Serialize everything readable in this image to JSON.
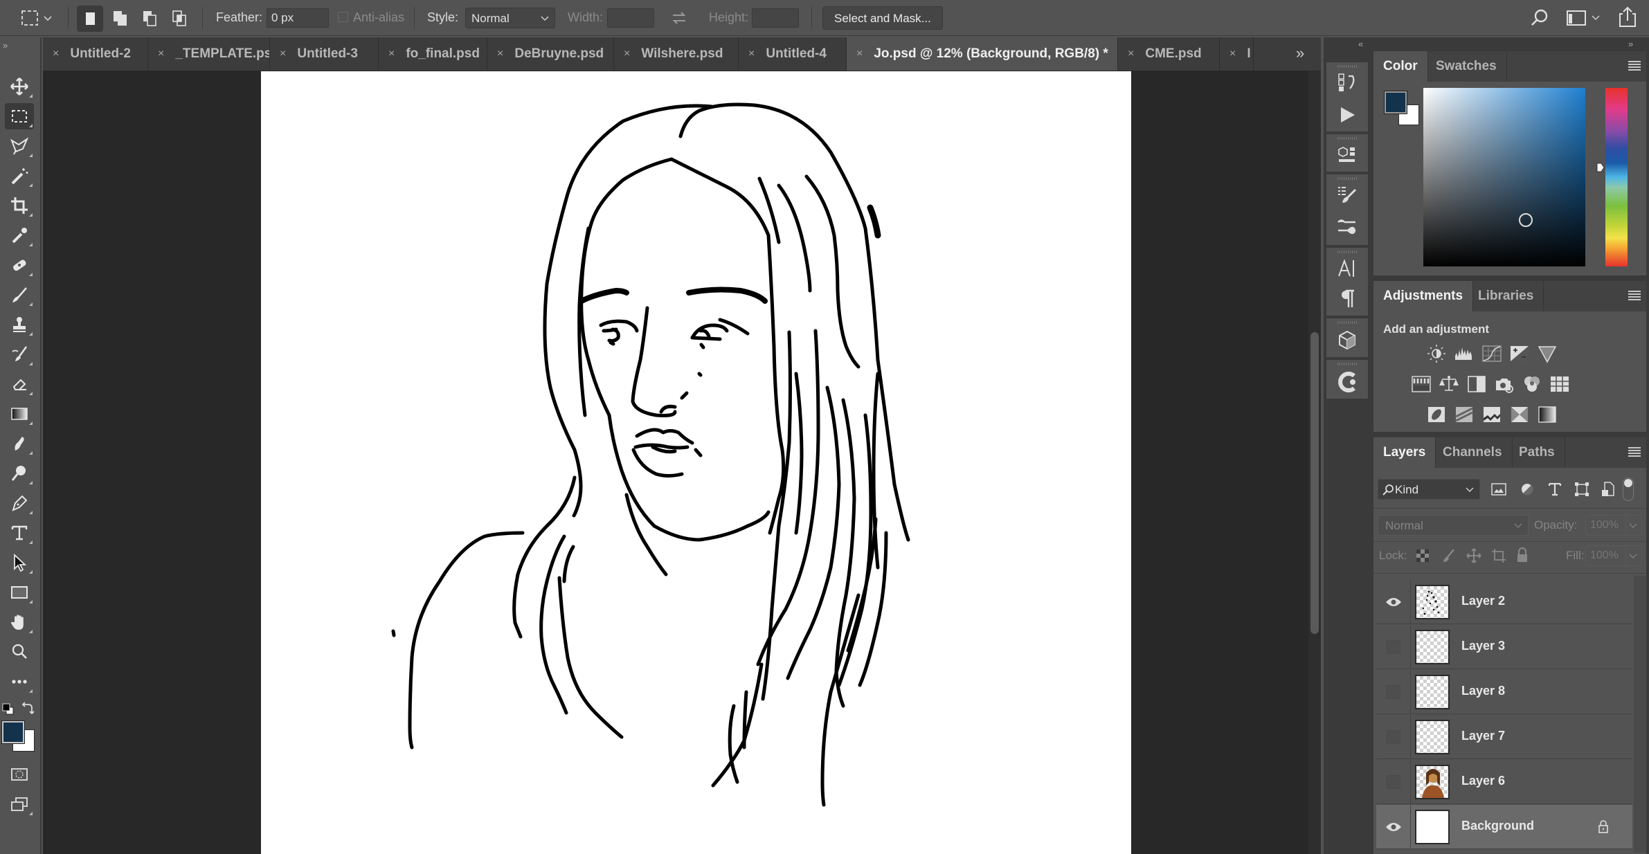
{
  "options_bar": {
    "feather_label": "Feather:",
    "feather_value": "0 px",
    "antialias_label": "Anti-alias",
    "style_label": "Style:",
    "style_value": "Normal",
    "width_label": "Width:",
    "width_value": "",
    "height_label": "Height:",
    "height_value": "",
    "select_mask_label": "Select and Mask..."
  },
  "tabs": [
    {
      "label": "Untitled-2",
      "active": false
    },
    {
      "label": "_TEMPLATE.psd",
      "active": false
    },
    {
      "label": "Untitled-3",
      "active": false
    },
    {
      "label": "fo_final.psd",
      "active": false
    },
    {
      "label": "DeBruyne.psd",
      "active": false
    },
    {
      "label": "Wilshere.psd",
      "active": false
    },
    {
      "label": "Untitled-4",
      "active": false
    },
    {
      "label": "Jo.psd @ 12% (Background, RGB/8) *",
      "active": true
    },
    {
      "label": "CME.psd",
      "active": false
    },
    {
      "label": "I",
      "active": false
    }
  ],
  "tab_close_glyph": "×",
  "tab_overflow_glyph": "»",
  "toolbar": {
    "tools": [
      "move-tool",
      "marquee-tool",
      "lasso-tool",
      "magic-wand-tool",
      "crop-tool",
      "eyedropper-tool",
      "healing-brush-tool",
      "brush-tool",
      "clone-stamp-tool",
      "history-brush-tool",
      "eraser-tool",
      "gradient-tool",
      "smudge-tool",
      "dodge-tool",
      "pen-tool",
      "type-tool",
      "path-selection-tool",
      "rectangle-tool",
      "hand-tool",
      "zoom-tool",
      "more-tools"
    ],
    "foreground_color": "#13324b",
    "background_color": "#ffffff"
  },
  "color_panel": {
    "tabs": [
      "Color",
      "Swatches"
    ],
    "active_tab": "Color",
    "foreground_color": "#13324b",
    "background_color": "#ffffff",
    "hue_color": "#1e7fd0"
  },
  "adjustments_panel": {
    "tabs": [
      "Adjustments",
      "Libraries"
    ],
    "active_tab": "Adjustments",
    "heading": "Add an adjustment",
    "rows": [
      [
        "brightness-contrast",
        "levels",
        "curves",
        "exposure",
        "vibrance"
      ],
      [
        "hue-saturation",
        "color-balance",
        "black-white",
        "photo-filter",
        "channel-mixer",
        "color-lookup"
      ],
      [
        "invert",
        "posterize",
        "threshold",
        "selective-color",
        "gradient-map"
      ]
    ]
  },
  "layers_panel": {
    "tabs": [
      "Layers",
      "Channels",
      "Paths"
    ],
    "active_tab": "Layers",
    "filter_label": "Kind",
    "blend_mode": "Normal",
    "opacity_label": "Opacity:",
    "opacity_value": "100%",
    "lock_label": "Lock:",
    "fill_label": "Fill:",
    "fill_value": "100%",
    "layers": [
      {
        "name": "Layer 2",
        "visible": true,
        "selected": false,
        "thumb": "sketch"
      },
      {
        "name": "Layer 3",
        "visible": false,
        "selected": false,
        "thumb": "transparent"
      },
      {
        "name": "Layer 8",
        "visible": false,
        "selected": false,
        "thumb": "transparent"
      },
      {
        "name": "Layer 7",
        "visible": false,
        "selected": false,
        "thumb": "transparent"
      },
      {
        "name": "Layer 6",
        "visible": false,
        "selected": false,
        "thumb": "photo"
      },
      {
        "name": "Background",
        "visible": true,
        "selected": true,
        "thumb": "white",
        "locked": true
      }
    ]
  }
}
